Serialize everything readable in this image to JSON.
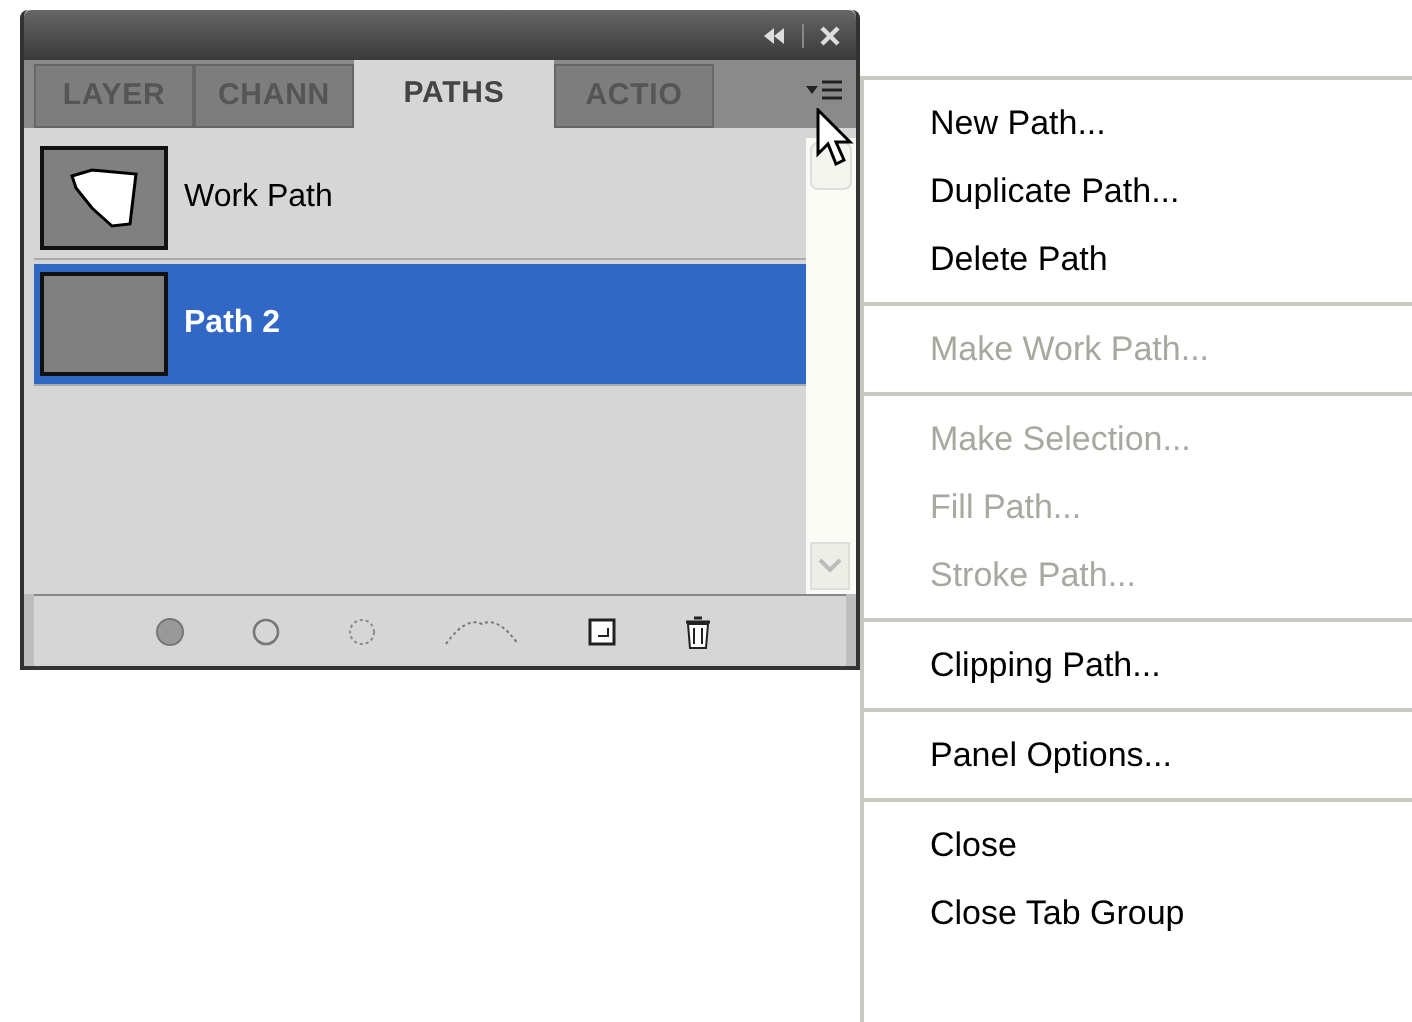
{
  "panel": {
    "tabs": [
      {
        "label": "LAYER",
        "selected": false
      },
      {
        "label": "CHANN",
        "selected": false
      },
      {
        "label": "PATHS",
        "selected": true
      },
      {
        "label": "ACTIO",
        "selected": false
      }
    ],
    "paths": [
      {
        "name": "Work Path",
        "selected": false,
        "kind": "shape"
      },
      {
        "name": "Path 2",
        "selected": true,
        "kind": "empty"
      }
    ]
  },
  "menu": {
    "groups": [
      [
        {
          "label": "New Path...",
          "disabled": false
        },
        {
          "label": "Duplicate Path...",
          "disabled": false
        },
        {
          "label": "Delete Path",
          "disabled": false
        }
      ],
      [
        {
          "label": "Make Work Path...",
          "disabled": true
        }
      ],
      [
        {
          "label": "Make Selection...",
          "disabled": true
        },
        {
          "label": "Fill Path...",
          "disabled": true
        },
        {
          "label": "Stroke Path...",
          "disabled": true
        }
      ],
      [
        {
          "label": "Clipping Path...",
          "disabled": false
        }
      ],
      [
        {
          "label": "Panel Options...",
          "disabled": false
        }
      ],
      [
        {
          "label": "Close",
          "disabled": false
        },
        {
          "label": "Close Tab Group",
          "disabled": false
        }
      ]
    ]
  }
}
